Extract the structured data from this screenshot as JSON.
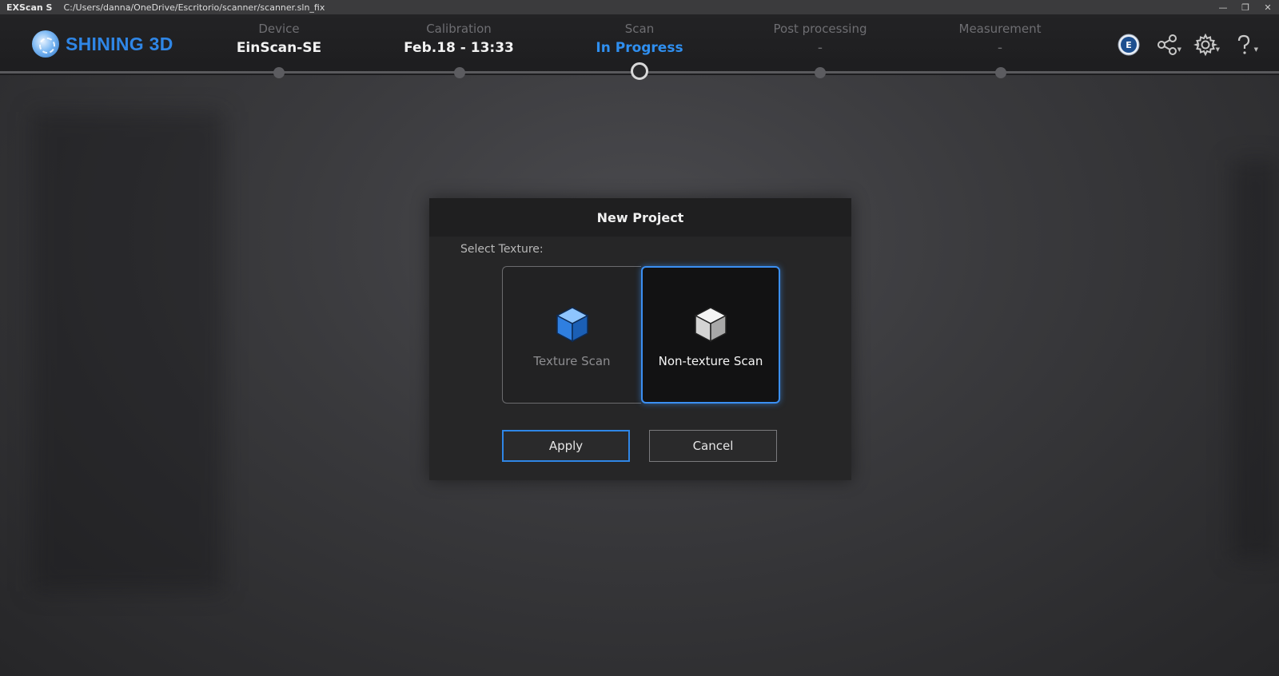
{
  "titlebar": {
    "app": "EXScan S",
    "path": "C:/Users/danna/OneDrive/Escritorio/scanner/scanner.sln_fix"
  },
  "brand": {
    "name": "SHINING 3D"
  },
  "steps": [
    {
      "label": "Device",
      "value": "EinScan-SE",
      "state": "done"
    },
    {
      "label": "Calibration",
      "value": "Feb.18 - 13:33",
      "state": "done"
    },
    {
      "label": "Scan",
      "value": "In Progress",
      "state": "active"
    },
    {
      "label": "Post processing",
      "value": "-",
      "state": "pending"
    },
    {
      "label": "Measurement",
      "value": "-",
      "state": "pending"
    }
  ],
  "header_icons": [
    "einscan-badge-icon",
    "share-icon",
    "settings-gear-icon",
    "help-icon"
  ],
  "badge_text": "E",
  "dialog": {
    "title": "New Project",
    "select_label": "Select Texture:",
    "options": [
      {
        "label": "Texture Scan",
        "selected": false,
        "icon": "cube-blue-icon"
      },
      {
        "label": "Non-texture Scan",
        "selected": true,
        "icon": "cube-white-icon"
      }
    ],
    "apply_label": "Apply",
    "cancel_label": "Cancel"
  },
  "colors": {
    "accent": "#2f86e6",
    "active_step": "#2f8ff0",
    "background": "#3a3a3d"
  }
}
